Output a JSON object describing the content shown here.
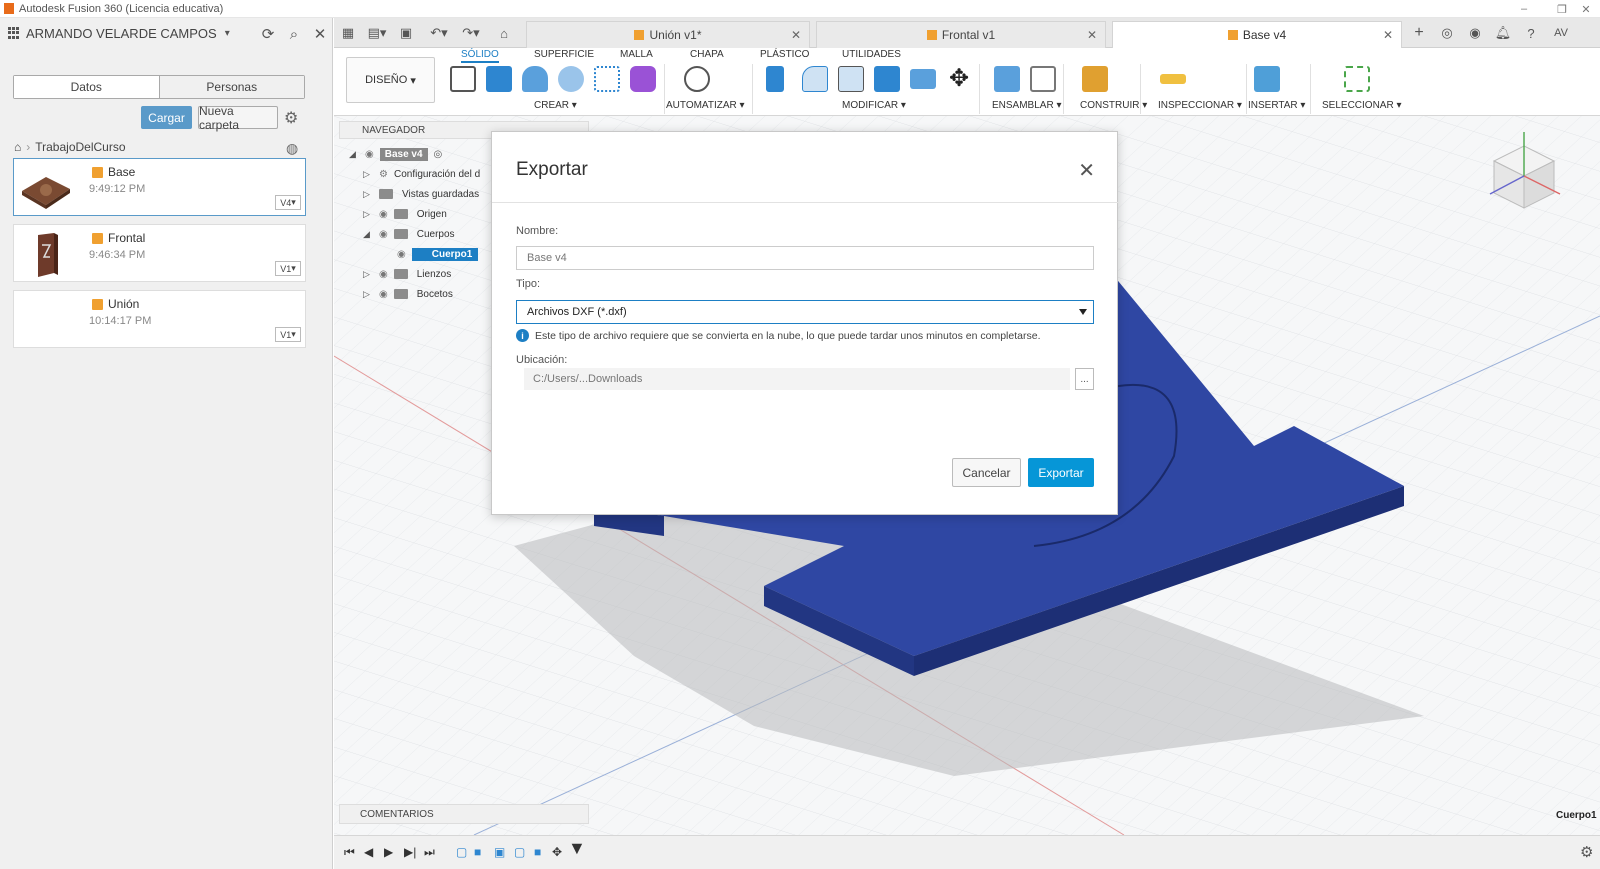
{
  "window": {
    "title": "Autodesk Fusion 360 (Licencia educativa)",
    "min": "–",
    "max": "❐",
    "close": "✕"
  },
  "left_panel": {
    "user_name": "ARMANDO VELARDE CAMPOS",
    "tabs": [
      "Datos",
      "Personas"
    ],
    "upload_label": "Cargar",
    "new_folder_label": "Nueva carpeta",
    "breadcrumb": "TrabajoDelCurso",
    "files": [
      {
        "name": "Base",
        "time": "9:49:12 PM",
        "version": "V4"
      },
      {
        "name": "Frontal",
        "time": "9:46:34 PM",
        "version": "V1"
      },
      {
        "name": "Unión",
        "time": "10:14:17 PM",
        "version": "V1"
      }
    ]
  },
  "doc_tabs": [
    {
      "label": "Unión v1*"
    },
    {
      "label": "Frontal v1"
    },
    {
      "label": "Base v4"
    }
  ],
  "user_initials": "AV",
  "toolbar": {
    "workspace_tabs": [
      "SÓLIDO",
      "SUPERFICIE",
      "MALLA",
      "CHAPA",
      "PLÁSTICO",
      "UTILIDADES"
    ],
    "design_label": "DISEÑO",
    "groups": [
      "CREAR",
      "AUTOMATIZAR",
      "MODIFICAR",
      "ENSAMBLAR",
      "CONSTRUIR",
      "INSPECCIONAR",
      "INSERTAR",
      "SELECCIONAR"
    ]
  },
  "navigator": {
    "title": "NAVEGADOR",
    "root": "Base v4",
    "items": [
      "Configuración del d",
      "Vistas guardadas",
      "Origen",
      "Cuerpos",
      "Cuerpo1",
      "Lienzos",
      "Bocetos"
    ]
  },
  "comments_label": "COMENTARIOS",
  "status_body": "Cuerpo1",
  "dialog": {
    "title": "Exportar",
    "name_label": "Nombre:",
    "name_value": "Base v4",
    "type_label": "Tipo:",
    "type_value": "Archivos DXF (*.dxf)",
    "info_text": "Este tipo de archivo requiere que se convierta en la nube, lo que puede tardar unos minutos en completarse.",
    "location_label": "Ubicación:",
    "location_value": "C:/Users/...Downloads",
    "browse_label": "...",
    "cancel_label": "Cancelar",
    "export_label": "Exportar"
  },
  "colors": {
    "accent": "#0696d7",
    "body": "#2f47a3",
    "upload": "#5a9ac9"
  }
}
